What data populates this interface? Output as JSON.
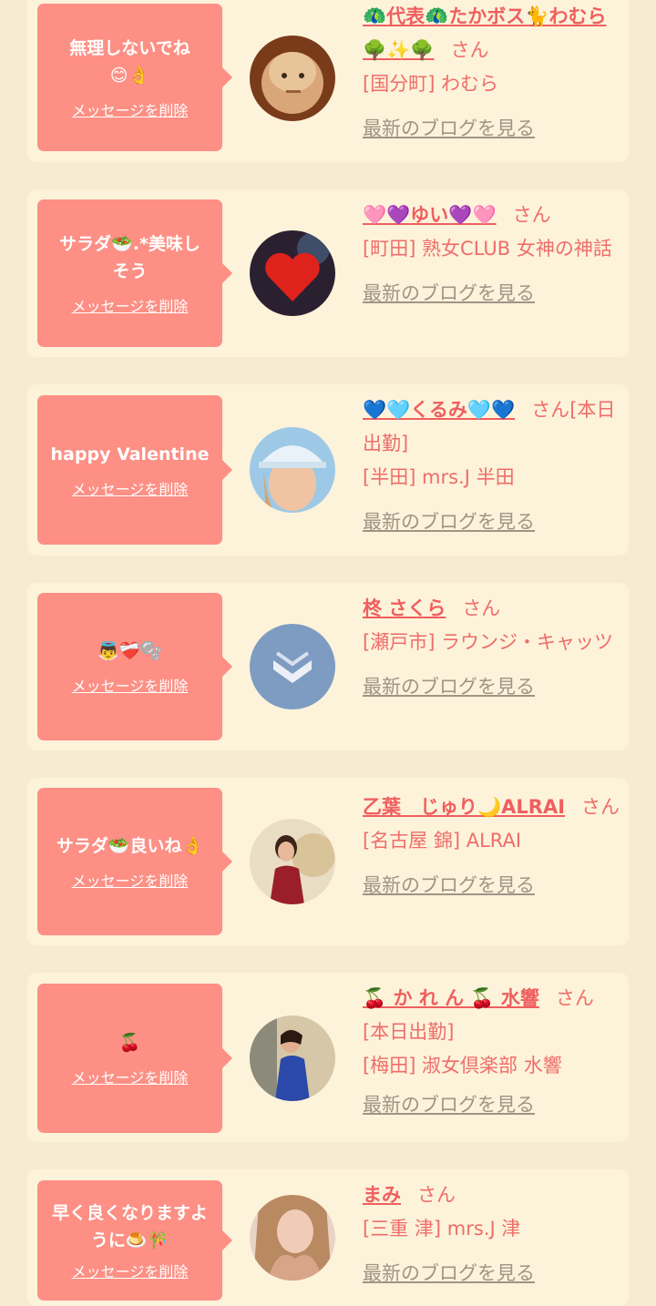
{
  "delete_label": "メッセージを削除",
  "blog_label": "最新のブログを見る",
  "san_label": "さん",
  "cards": [
    {
      "message": "無理しないでね",
      "message_emoji": "😊👌",
      "name_prefix": "🦚",
      "name": "代表",
      "name_mid": "🦚",
      "name2": "たかボス",
      "name_emoji": "🐈",
      "name3": "わむら",
      "name_suffix": "🌳✨🌳",
      "status": "",
      "shop": "[国分町] わむら",
      "avatar": "face-doll"
    },
    {
      "message": "サラダ🥗.*美味しそう",
      "message_emoji": "",
      "name_prefix": "🩷💜",
      "name": "ゆい",
      "name_mid": "",
      "name2": "",
      "name_emoji": "",
      "name3": "",
      "name_suffix": "💜🩷",
      "status": "",
      "shop": "[町田] 熟女CLUB 女神の神話",
      "avatar": "heart"
    },
    {
      "message": "happy Valentine",
      "message_emoji": "",
      "name_prefix": "💙🩵",
      "name": "くるみ",
      "name_mid": "",
      "name2": "",
      "name_emoji": "",
      "name3": "",
      "name_suffix": "🩵💙",
      "status": "[本日出勤]",
      "shop": "[半田] mrs.J 半田",
      "avatar": "cap-girl"
    },
    {
      "message": "",
      "message_emoji": "👼❤️‍🩹🫧",
      "name_prefix": "",
      "name": "柊 さくら",
      "name_mid": "",
      "name2": "",
      "name_emoji": "",
      "name3": "",
      "name_suffix": "",
      "status": "",
      "shop": "[瀬戸市] ラウンジ・キャッツ",
      "avatar": "default"
    },
    {
      "message": "サラダ🥗良いね👌",
      "message_emoji": "",
      "name_prefix": "",
      "name": "乙葉　じゅり",
      "name_mid": "",
      "name2": "",
      "name_emoji": "🌙",
      "name3": "ALRAI",
      "name_suffix": "",
      "status": "",
      "shop": "[名古屋 錦] ALRAI",
      "avatar": "red-dress"
    },
    {
      "message": "",
      "message_emoji": "🍒",
      "name_prefix": "🍒",
      "name": " か れ ん ",
      "name_mid": "🍒",
      "name2": " 水響",
      "name_emoji": "",
      "name3": "",
      "name_suffix": "",
      "status": "[本日出勤]",
      "shop": "[梅田] 淑女倶楽部 水響",
      "avatar": "blue-dress"
    },
    {
      "message": "早く良くなりますように",
      "message_emoji": "🍮🎋",
      "name_prefix": "",
      "name": "まみ",
      "name_mid": "",
      "name2": "",
      "name_emoji": "",
      "name3": "",
      "name_suffix": "",
      "status": "",
      "shop": "[三重 津] mrs.J 津",
      "avatar": "hair"
    }
  ]
}
